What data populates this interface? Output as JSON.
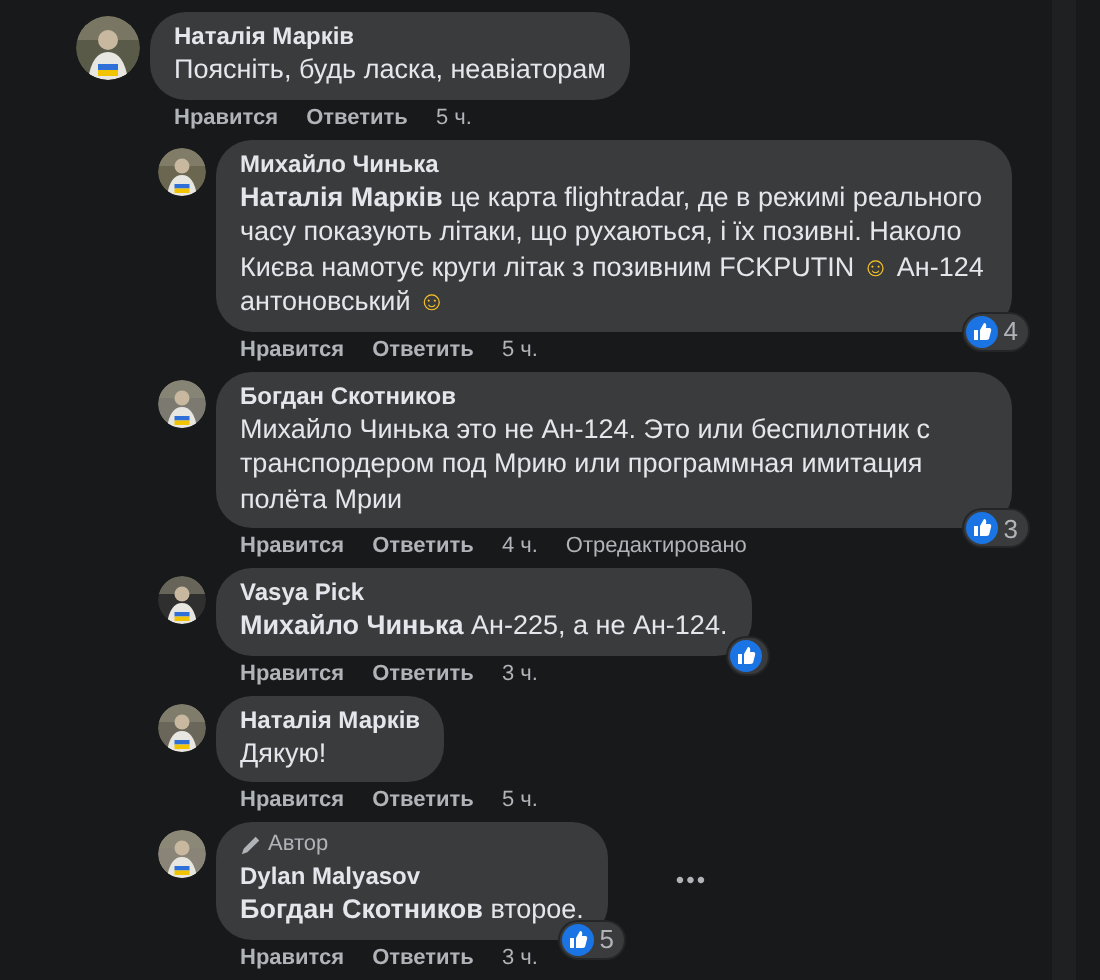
{
  "comments": [
    {
      "author": "Наталія Марків",
      "message": [
        {
          "kind": "text",
          "text": "Поясніть, будь ласка, неавіаторам"
        }
      ],
      "actions": {
        "like": "Нравится",
        "reply": "Ответить",
        "time": "5 ч."
      },
      "children": [
        {
          "author": "Михайло Чинька",
          "message": [
            {
              "kind": "mention",
              "text": "Наталія Марків"
            },
            {
              "kind": "text",
              "text": " це карта flightradar, де в режимі реального часу показують літаки, що рухаються, і їх позивні. Наколо Києва намотує круги літак з позивним FCKPUTIN "
            },
            {
              "kind": "emoji",
              "text": "☺"
            },
            {
              "kind": "text",
              "text": " Ан-124 антоновський "
            },
            {
              "kind": "emoji",
              "text": "☺"
            }
          ],
          "reactions": "4",
          "actions": {
            "like": "Нравится",
            "reply": "Ответить",
            "time": "5 ч."
          }
        },
        {
          "author": "Богдан Скотников",
          "message": [
            {
              "kind": "text",
              "text": "Михайло Чинька это не Ан-124. Это или беспилотник с транспордером под Мрию или программная имитация полёта Мрии"
            }
          ],
          "reactions": "3",
          "actions": {
            "like": "Нравится",
            "reply": "Ответить",
            "time": "4 ч.",
            "edited": "Отредактировано"
          }
        },
        {
          "author": "Vasya Pick",
          "message": [
            {
              "kind": "mention",
              "text": "Михайло Чинька"
            },
            {
              "kind": "text",
              "text": " Ан-225, а не Ан-124."
            }
          ],
          "liked": true,
          "actions": {
            "like": "Нравится",
            "reply": "Ответить",
            "time": "3 ч."
          }
        },
        {
          "author": "Наталія Марків",
          "message": [
            {
              "kind": "text",
              "text": "Дякую!"
            }
          ],
          "actions": {
            "like": "Нравится",
            "reply": "Ответить",
            "time": "5 ч."
          }
        },
        {
          "badge": "Автор",
          "author": "Dylan Malyasov",
          "message": [
            {
              "kind": "mention",
              "text": "Богдан Скотников"
            },
            {
              "kind": "text",
              "text": " второе."
            }
          ],
          "reactions": "5",
          "more": "•••",
          "actions": {
            "like": "Нравится",
            "reply": "Ответить",
            "time": "3 ч."
          }
        }
      ]
    }
  ]
}
